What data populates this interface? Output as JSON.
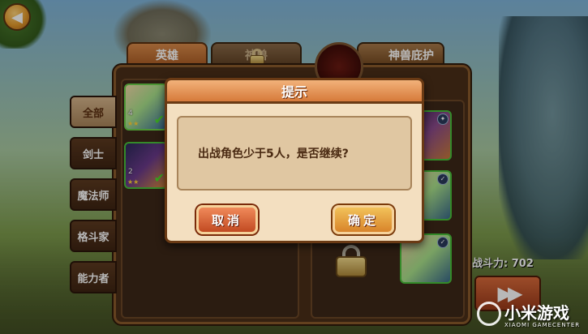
{
  "tabs": {
    "heroes": "英雄",
    "beast": "神兽",
    "guard": "神兽庇护"
  },
  "side_menu": [
    "全部",
    "剑士",
    "魔法师",
    "格斗家",
    "能力者"
  ],
  "hero_list": [
    {
      "level": "4",
      "stars": "★★"
    },
    {
      "level": "2",
      "stars": "★★"
    }
  ],
  "power": {
    "label": "战斗力:",
    "value": "702"
  },
  "dialog": {
    "title": "提示",
    "message": "出战角色少于5人，是否继续?",
    "cancel": "取消",
    "confirm": "确定"
  },
  "watermark": {
    "title": "小米游戏",
    "subtitle": "XIAOMI GAMECENTER"
  },
  "colors": {
    "accent": "#d67a3a",
    "panel": "#4a2e18",
    "dialog": "#f3dfc0"
  }
}
